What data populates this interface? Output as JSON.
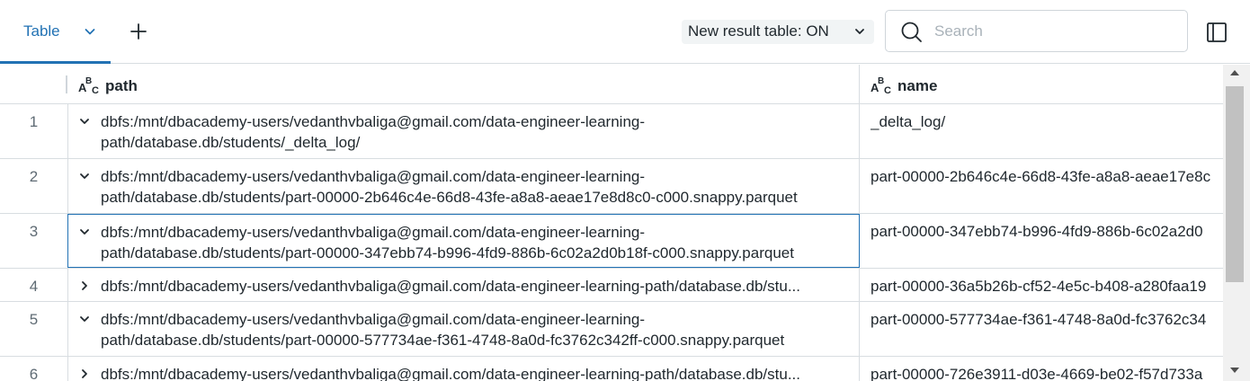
{
  "toolbar": {
    "tab_label": "Table",
    "result_table_label": "New result table: ON",
    "search_placeholder": "Search"
  },
  "columns": [
    {
      "label": "path",
      "type_icon": "abc-string-type-icon"
    },
    {
      "label": "name",
      "type_icon": "abc-string-type-icon"
    }
  ],
  "rows": [
    {
      "index": "1",
      "expanded": true,
      "path": "dbfs:/mnt/dbacademy-users/vedanthvbaliga@gmail.com/data-engineer-learning-\npath/database.db/students/_delta_log/",
      "name": "_delta_log/"
    },
    {
      "index": "2",
      "expanded": true,
      "path": "dbfs:/mnt/dbacademy-users/vedanthvbaliga@gmail.com/data-engineer-learning-\npath/database.db/students/part-00000-2b646c4e-66d8-43fe-a8a8-aeae17e8d8c0-c000.snappy.parquet",
      "name": "part-00000-2b646c4e-66d8-43fe-a8a8-aeae17e8c"
    },
    {
      "index": "3",
      "expanded": true,
      "selected": true,
      "path": "dbfs:/mnt/dbacademy-users/vedanthvbaliga@gmail.com/data-engineer-learning-\npath/database.db/students/part-00000-347ebb74-b996-4fd9-886b-6c02a2d0b18f-c000.snappy.parquet",
      "name": "part-00000-347ebb74-b996-4fd9-886b-6c02a2d0"
    },
    {
      "index": "4",
      "expanded": false,
      "path": "dbfs:/mnt/dbacademy-users/vedanthvbaliga@gmail.com/data-engineer-learning-path/database.db/stu...",
      "name": "part-00000-36a5b26b-cf52-4e5c-b408-a280faa19"
    },
    {
      "index": "5",
      "expanded": true,
      "path": "dbfs:/mnt/dbacademy-users/vedanthvbaliga@gmail.com/data-engineer-learning-\npath/database.db/students/part-00000-577734ae-f361-4748-8a0d-fc3762c342ff-c000.snappy.parquet",
      "name": "part-00000-577734ae-f361-4748-8a0d-fc3762c34"
    },
    {
      "index": "6",
      "expanded": false,
      "path": "dbfs:/mnt/dbacademy-users/vedanthvbaliga@gmail.com/data-engineer-learning-path/database.db/stu...",
      "name": "part-00000-726e3911-d03e-4669-be02-f57d733a"
    }
  ]
}
